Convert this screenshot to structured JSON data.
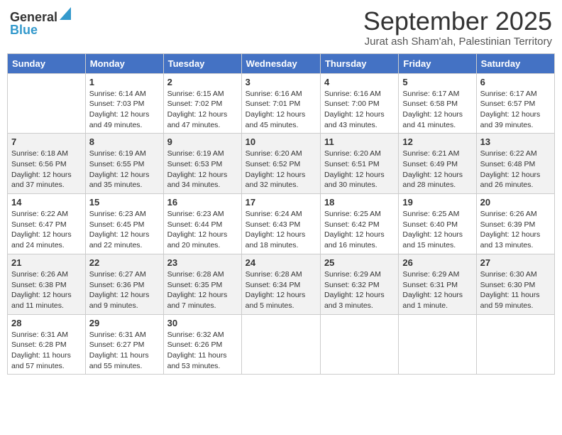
{
  "header": {
    "logo_general": "General",
    "logo_blue": "Blue",
    "month": "September 2025",
    "location": "Jurat ash Sham'ah, Palestinian Territory"
  },
  "days_of_week": [
    "Sunday",
    "Monday",
    "Tuesday",
    "Wednesday",
    "Thursday",
    "Friday",
    "Saturday"
  ],
  "weeks": [
    [
      {
        "day": "",
        "sunrise": "",
        "sunset": "",
        "daylight": ""
      },
      {
        "day": "1",
        "sunrise": "Sunrise: 6:14 AM",
        "sunset": "Sunset: 7:03 PM",
        "daylight": "Daylight: 12 hours and 49 minutes."
      },
      {
        "day": "2",
        "sunrise": "Sunrise: 6:15 AM",
        "sunset": "Sunset: 7:02 PM",
        "daylight": "Daylight: 12 hours and 47 minutes."
      },
      {
        "day": "3",
        "sunrise": "Sunrise: 6:16 AM",
        "sunset": "Sunset: 7:01 PM",
        "daylight": "Daylight: 12 hours and 45 minutes."
      },
      {
        "day": "4",
        "sunrise": "Sunrise: 6:16 AM",
        "sunset": "Sunset: 7:00 PM",
        "daylight": "Daylight: 12 hours and 43 minutes."
      },
      {
        "day": "5",
        "sunrise": "Sunrise: 6:17 AM",
        "sunset": "Sunset: 6:58 PM",
        "daylight": "Daylight: 12 hours and 41 minutes."
      },
      {
        "day": "6",
        "sunrise": "Sunrise: 6:17 AM",
        "sunset": "Sunset: 6:57 PM",
        "daylight": "Daylight: 12 hours and 39 minutes."
      }
    ],
    [
      {
        "day": "7",
        "sunrise": "Sunrise: 6:18 AM",
        "sunset": "Sunset: 6:56 PM",
        "daylight": "Daylight: 12 hours and 37 minutes."
      },
      {
        "day": "8",
        "sunrise": "Sunrise: 6:19 AM",
        "sunset": "Sunset: 6:55 PM",
        "daylight": "Daylight: 12 hours and 35 minutes."
      },
      {
        "day": "9",
        "sunrise": "Sunrise: 6:19 AM",
        "sunset": "Sunset: 6:53 PM",
        "daylight": "Daylight: 12 hours and 34 minutes."
      },
      {
        "day": "10",
        "sunrise": "Sunrise: 6:20 AM",
        "sunset": "Sunset: 6:52 PM",
        "daylight": "Daylight: 12 hours and 32 minutes."
      },
      {
        "day": "11",
        "sunrise": "Sunrise: 6:20 AM",
        "sunset": "Sunset: 6:51 PM",
        "daylight": "Daylight: 12 hours and 30 minutes."
      },
      {
        "day": "12",
        "sunrise": "Sunrise: 6:21 AM",
        "sunset": "Sunset: 6:49 PM",
        "daylight": "Daylight: 12 hours and 28 minutes."
      },
      {
        "day": "13",
        "sunrise": "Sunrise: 6:22 AM",
        "sunset": "Sunset: 6:48 PM",
        "daylight": "Daylight: 12 hours and 26 minutes."
      }
    ],
    [
      {
        "day": "14",
        "sunrise": "Sunrise: 6:22 AM",
        "sunset": "Sunset: 6:47 PM",
        "daylight": "Daylight: 12 hours and 24 minutes."
      },
      {
        "day": "15",
        "sunrise": "Sunrise: 6:23 AM",
        "sunset": "Sunset: 6:45 PM",
        "daylight": "Daylight: 12 hours and 22 minutes."
      },
      {
        "day": "16",
        "sunrise": "Sunrise: 6:23 AM",
        "sunset": "Sunset: 6:44 PM",
        "daylight": "Daylight: 12 hours and 20 minutes."
      },
      {
        "day": "17",
        "sunrise": "Sunrise: 6:24 AM",
        "sunset": "Sunset: 6:43 PM",
        "daylight": "Daylight: 12 hours and 18 minutes."
      },
      {
        "day": "18",
        "sunrise": "Sunrise: 6:25 AM",
        "sunset": "Sunset: 6:42 PM",
        "daylight": "Daylight: 12 hours and 16 minutes."
      },
      {
        "day": "19",
        "sunrise": "Sunrise: 6:25 AM",
        "sunset": "Sunset: 6:40 PM",
        "daylight": "Daylight: 12 hours and 15 minutes."
      },
      {
        "day": "20",
        "sunrise": "Sunrise: 6:26 AM",
        "sunset": "Sunset: 6:39 PM",
        "daylight": "Daylight: 12 hours and 13 minutes."
      }
    ],
    [
      {
        "day": "21",
        "sunrise": "Sunrise: 6:26 AM",
        "sunset": "Sunset: 6:38 PM",
        "daylight": "Daylight: 12 hours and 11 minutes."
      },
      {
        "day": "22",
        "sunrise": "Sunrise: 6:27 AM",
        "sunset": "Sunset: 6:36 PM",
        "daylight": "Daylight: 12 hours and 9 minutes."
      },
      {
        "day": "23",
        "sunrise": "Sunrise: 6:28 AM",
        "sunset": "Sunset: 6:35 PM",
        "daylight": "Daylight: 12 hours and 7 minutes."
      },
      {
        "day": "24",
        "sunrise": "Sunrise: 6:28 AM",
        "sunset": "Sunset: 6:34 PM",
        "daylight": "Daylight: 12 hours and 5 minutes."
      },
      {
        "day": "25",
        "sunrise": "Sunrise: 6:29 AM",
        "sunset": "Sunset: 6:32 PM",
        "daylight": "Daylight: 12 hours and 3 minutes."
      },
      {
        "day": "26",
        "sunrise": "Sunrise: 6:29 AM",
        "sunset": "Sunset: 6:31 PM",
        "daylight": "Daylight: 12 hours and 1 minute."
      },
      {
        "day": "27",
        "sunrise": "Sunrise: 6:30 AM",
        "sunset": "Sunset: 6:30 PM",
        "daylight": "Daylight: 11 hours and 59 minutes."
      }
    ],
    [
      {
        "day": "28",
        "sunrise": "Sunrise: 6:31 AM",
        "sunset": "Sunset: 6:28 PM",
        "daylight": "Daylight: 11 hours and 57 minutes."
      },
      {
        "day": "29",
        "sunrise": "Sunrise: 6:31 AM",
        "sunset": "Sunset: 6:27 PM",
        "daylight": "Daylight: 11 hours and 55 minutes."
      },
      {
        "day": "30",
        "sunrise": "Sunrise: 6:32 AM",
        "sunset": "Sunset: 6:26 PM",
        "daylight": "Daylight: 11 hours and 53 minutes."
      },
      {
        "day": "",
        "sunrise": "",
        "sunset": "",
        "daylight": ""
      },
      {
        "day": "",
        "sunrise": "",
        "sunset": "",
        "daylight": ""
      },
      {
        "day": "",
        "sunrise": "",
        "sunset": "",
        "daylight": ""
      },
      {
        "day": "",
        "sunrise": "",
        "sunset": "",
        "daylight": ""
      }
    ]
  ]
}
